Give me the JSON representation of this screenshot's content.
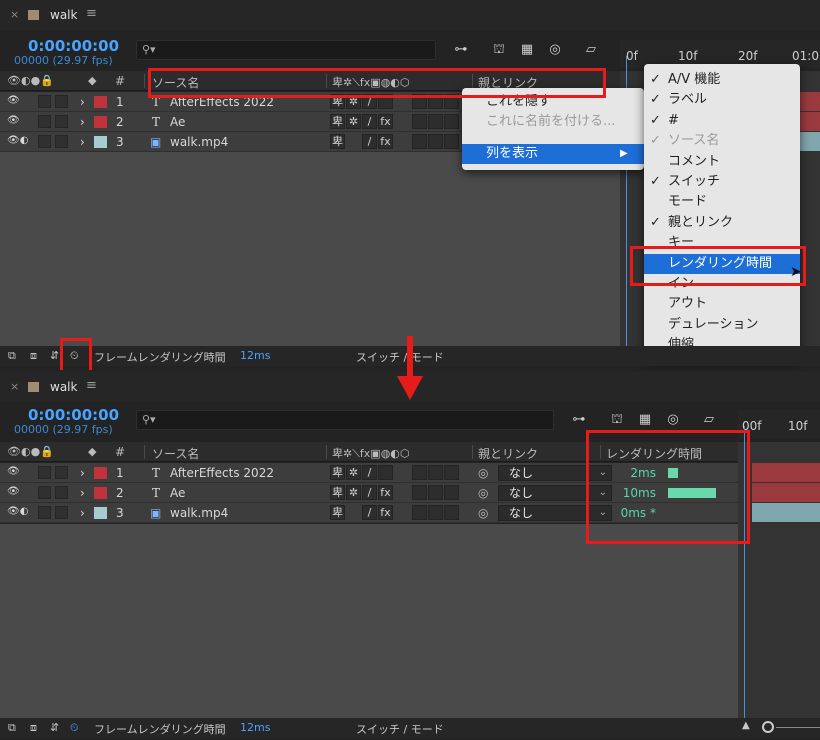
{
  "panel": {
    "close": "×",
    "title": "walk",
    "menu": "≡",
    "timecode": "0:00:00:00",
    "fps": "00000 (29.97 fps)",
    "search_glyph": "⚲▾",
    "columns": {
      "source": "ソース名",
      "hash": "#",
      "parent": "親とリンク",
      "render": "レンダリング時間"
    },
    "switch_icons": "卑✲⟍fx▣◍◐⬡"
  },
  "layers": [
    {
      "num": "1",
      "type": "T",
      "name": "AfterEffects 2022",
      "label_color": "#c0333c",
      "sw1": "卑",
      "sw2": "✲",
      "sw3": "/",
      "sw4": "",
      "parent": "なし",
      "render": "2ms",
      "render_fraction": 0.2
    },
    {
      "num": "2",
      "type": "T",
      "name": "Ae",
      "label_color": "#c0333c",
      "sw1": "卑",
      "sw2": "✲",
      "sw3": "/",
      "sw4": "fx",
      "parent": "なし",
      "render": "10ms",
      "render_fraction": 1.0
    },
    {
      "num": "3",
      "type": "▣",
      "name": "walk.mp4",
      "label_color": "#a6ccd2",
      "sw1": "卑",
      "sw2": "",
      "sw3": "/",
      "sw4": "fx",
      "parent": "なし",
      "render": "0ms *",
      "render_fraction": 0
    }
  ],
  "timeline": {
    "top_ruler": [
      "0f",
      "10f",
      "20f",
      "01:0"
    ],
    "bottom_ruler": [
      "00f",
      "10f"
    ]
  },
  "footer": {
    "frame_render_label": "フレームレンダリング時間",
    "frame_render_value": "12ms",
    "toggle_label": "スイッチ / モード"
  },
  "context_menu": {
    "hide": "これを隠す",
    "rename": "これに名前を付ける...",
    "show_columns": "列を表示",
    "submenu_arrow": "▶"
  },
  "columns_menu": [
    {
      "check": "✓",
      "label": "A/V 機能"
    },
    {
      "check": "✓",
      "label": "ラベル"
    },
    {
      "check": "✓",
      "label": "#"
    },
    {
      "check": "✓",
      "label": "ソース名",
      "disabled": true
    },
    {
      "check": "",
      "label": "コメント"
    },
    {
      "check": "✓",
      "label": "スイッチ"
    },
    {
      "check": "",
      "label": "モード"
    },
    {
      "check": "✓",
      "label": "親とリンク"
    },
    {
      "check": "",
      "label": "キー"
    },
    {
      "check": "",
      "label": "レンダリング時間",
      "highlight": true
    },
    {
      "check": "",
      "label": "イン"
    },
    {
      "check": "",
      "label": "アウト"
    },
    {
      "check": "",
      "label": "デュレーション"
    },
    {
      "check": "",
      "label": "伸縮"
    }
  ],
  "colors": {
    "accent_blue": "#4aa3ff",
    "render_green": "#58d6a7",
    "annotation_red": "#e81b1b",
    "menu_highlight": "#1e6ed8"
  }
}
